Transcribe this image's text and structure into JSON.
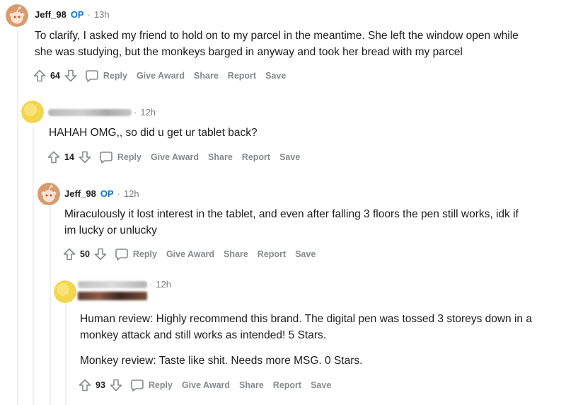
{
  "comments": [
    {
      "username": "Jeff_98",
      "op_badge": "OP",
      "time": "13h",
      "body": [
        "To clarify, I asked my friend to hold on to my parcel in the meantime. She left the window open while she was studying, but the monkeys barged in anyway and took her bread with my parcel"
      ],
      "score": "64"
    },
    {
      "username": "",
      "time": "12h",
      "body": [
        "HAHAH OMG,, so did u get ur tablet back?"
      ],
      "score": "14"
    },
    {
      "username": "Jeff_98",
      "op_badge": "OP",
      "time": "12h",
      "body": [
        "Miraculously it lost interest in the tablet, and even after falling 3 floors the pen still works, idk if im lucky or unlucky"
      ],
      "score": "50"
    },
    {
      "username": "",
      "time": "12h",
      "body": [
        "Human review: Highly recommend this brand. The digital pen was tossed 3 storeys down in a monkey attack and still works as intended! 5 Stars.",
        "Monkey review: Taste like shit. Needs more MSG. 0 Stars."
      ],
      "score": "93"
    }
  ],
  "actions": {
    "reply": "Reply",
    "give_award": "Give Award",
    "share": "Share",
    "report": "Report",
    "save": "Save"
  },
  "separator": "·",
  "colors": {
    "op_badge": "#0079d3",
    "meta_text": "#7c7c7c",
    "action_text": "#878a8c",
    "thread_line": "#edeff1",
    "avatar_snoo": "#d99a6c",
    "avatar_yellow": "#f2d64b"
  },
  "icons": [
    "snoo-avatar-icon",
    "yellow-avatar-icon",
    "upvote-arrow-icon",
    "downvote-arrow-icon",
    "comment-bubble-icon"
  ]
}
